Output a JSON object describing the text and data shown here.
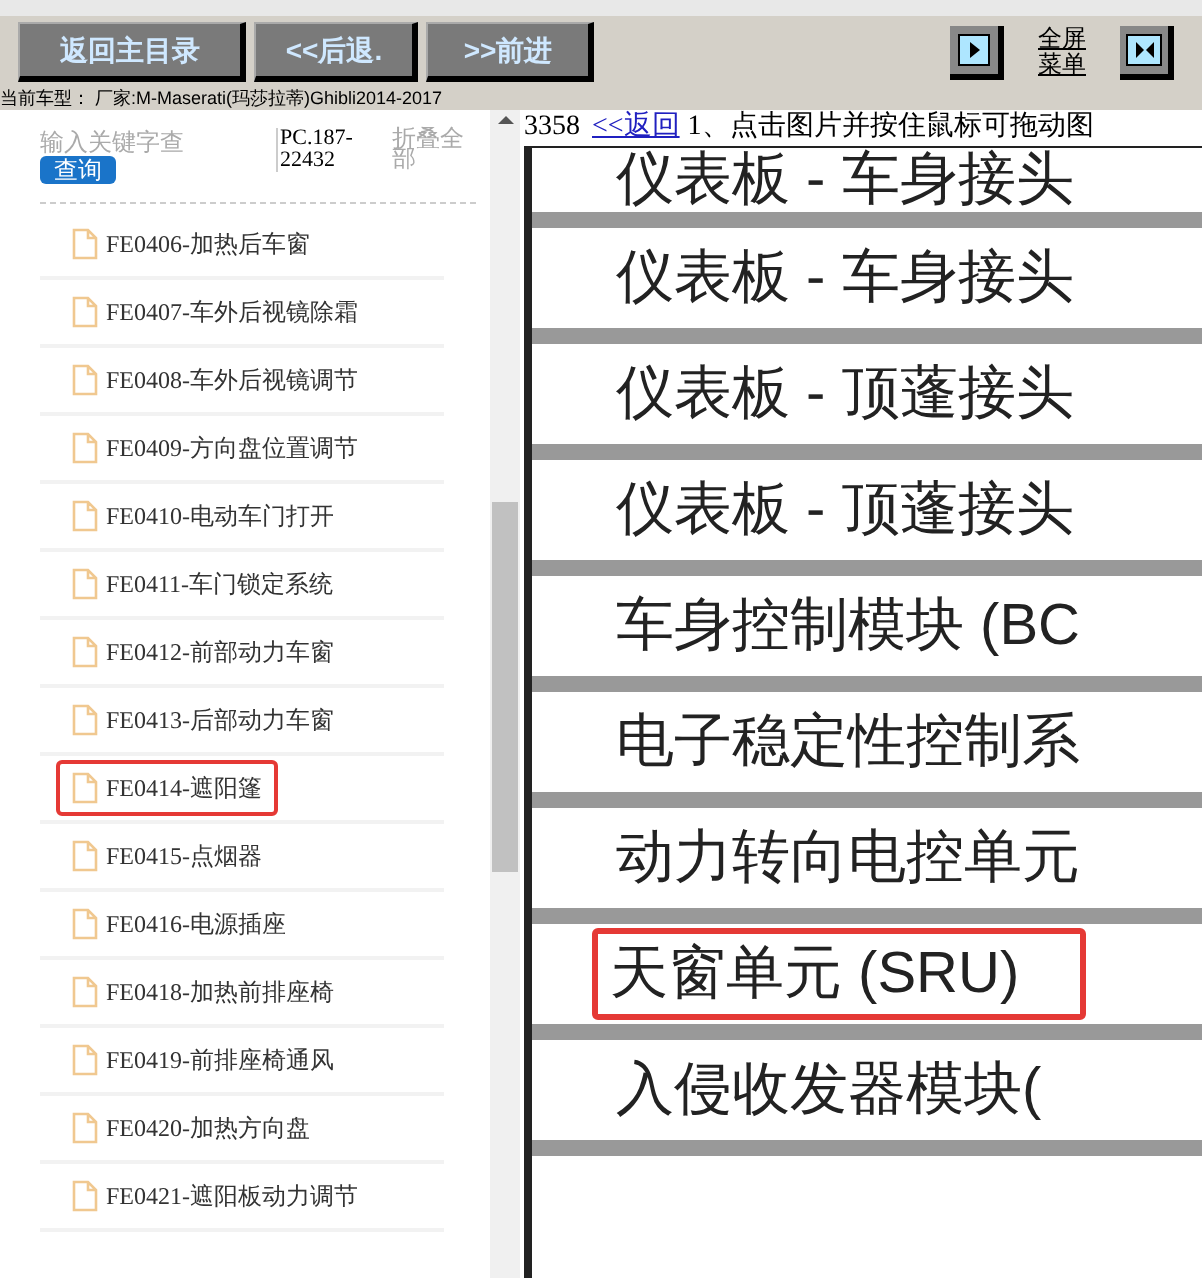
{
  "toolbar": {
    "buttons": [
      "返回主目录",
      "<<后退.",
      ">>前进"
    ],
    "fullscreen_menu": "全屏菜单"
  },
  "model_line": "当前车型： 厂家:M-Maserati(玛莎拉蒂)Ghibli2014-2017",
  "sidebar": {
    "search": {
      "placeholder": "输入关键字查"
    },
    "search_button": "查询",
    "code": "PC.187-22432",
    "collapse_all": "折叠全部",
    "items": [
      {
        "label": "FE0406-加热后车窗",
        "highlighted": false
      },
      {
        "label": "FE0407-车外后视镜除霜",
        "highlighted": false
      },
      {
        "label": "FE0408-车外后视镜调节",
        "highlighted": false
      },
      {
        "label": "FE0409-方向盘位置调节",
        "highlighted": false
      },
      {
        "label": "FE0410-电动车门打开",
        "highlighted": false
      },
      {
        "label": "FE0411-车门锁定系统",
        "highlighted": false
      },
      {
        "label": "FE0412-前部动力车窗",
        "highlighted": false
      },
      {
        "label": "FE0413-后部动力车窗",
        "highlighted": false
      },
      {
        "label": "FE0414-遮阳篷",
        "highlighted": true
      },
      {
        "label": "FE0415-点烟器",
        "highlighted": false
      },
      {
        "label": "FE0416-电源插座",
        "highlighted": false
      },
      {
        "label": "FE0418-加热前排座椅",
        "highlighted": false
      },
      {
        "label": "FE0419-前排座椅通风",
        "highlighted": false
      },
      {
        "label": "FE0420-加热方向盘",
        "highlighted": false
      },
      {
        "label": "FE0421-遮阳板动力调节",
        "highlighted": false
      }
    ]
  },
  "content": {
    "page_number": "3358",
    "back_link": "<<返回",
    "instruction": "1、点击图片并按住鼠标可拖动图",
    "diagram_rows": [
      {
        "label": "仪表板 - 车身接头",
        "highlighted": false
      },
      {
        "label": "仪表板 - 车身接头",
        "highlighted": false
      },
      {
        "label": "仪表板 - 顶蓬接头",
        "highlighted": false
      },
      {
        "label": "仪表板 - 顶蓬接头",
        "highlighted": false
      },
      {
        "label": "车身控制模块 (BC",
        "highlighted": false
      },
      {
        "label": "电子稳定性控制系",
        "highlighted": false
      },
      {
        "label": "动力转向电控单元",
        "highlighted": false
      },
      {
        "label": "天窗单元 (SRU)",
        "highlighted": true
      },
      {
        "label": "入侵收发器模块(",
        "highlighted": false
      }
    ]
  }
}
